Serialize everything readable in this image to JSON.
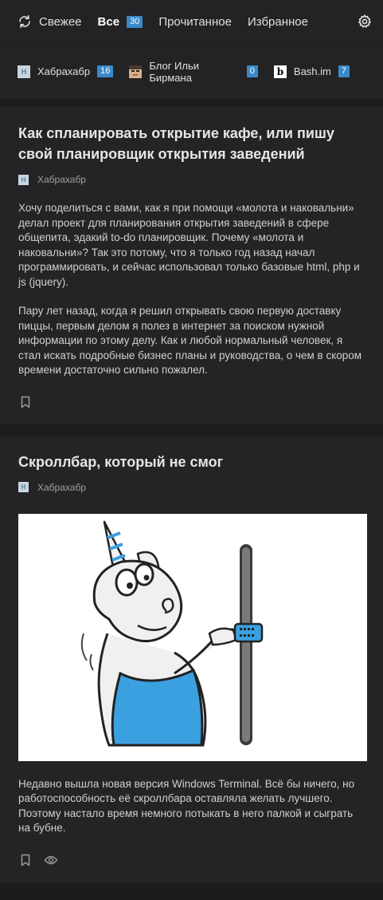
{
  "topnav": {
    "refresh_icon": "refresh-icon",
    "fresh": "Свежее",
    "all": "Все",
    "all_count": "30",
    "read": "Прочитанное",
    "favorites": "Избранное",
    "settings_icon": "gear-icon"
  },
  "sources": [
    {
      "name": "Хабрахабр",
      "count": "16",
      "icon": "H"
    },
    {
      "name": "Блог Ильи Бирмана",
      "count": "0",
      "icon": "face"
    },
    {
      "name": "Bash.im",
      "count": "7",
      "icon": "b"
    }
  ],
  "articles": [
    {
      "title": "Как спланировать открытие кафе, или пишу свой планировщик открытия заведений",
      "source": "Хабрахабр",
      "paragraphs": [
        "Хочу поделиться с вами, как я при помощи «молота и наковальни» делал проект для планирования открытия заведений в сфере общепита, эдакий to-do планировщик. Почему «молота и наковальни»? Так это потому, что я только год назад начал программировать, и сейчас использовал только базовые html, php и js (jquery).",
        "Пару лет назад, когда я решил открывать свою первую доставку пиццы, первым делом я полез в интернет за поиском нужной информации по этому делу. Как и любой нормальный человек, я стал искать подробные бизнес планы и руководства, о чем в скором времени достаточно сильно пожалел."
      ]
    },
    {
      "title": "Скроллбар, который не смог",
      "source": "Хабрахабр",
      "paragraphs": [
        "Недавно вышла новая версия Windows Terminal. Всё бы ничего, но работоспособность её скроллбара оставляла желать лучшего. Поэтому настало время немного потыкать в него палкой и сыграть на бубне."
      ]
    }
  ],
  "colors": {
    "background": "#1c1c1e",
    "card": "#242426",
    "badge": "#3a89c9",
    "unicorn_accent": "#3ba0e0"
  }
}
